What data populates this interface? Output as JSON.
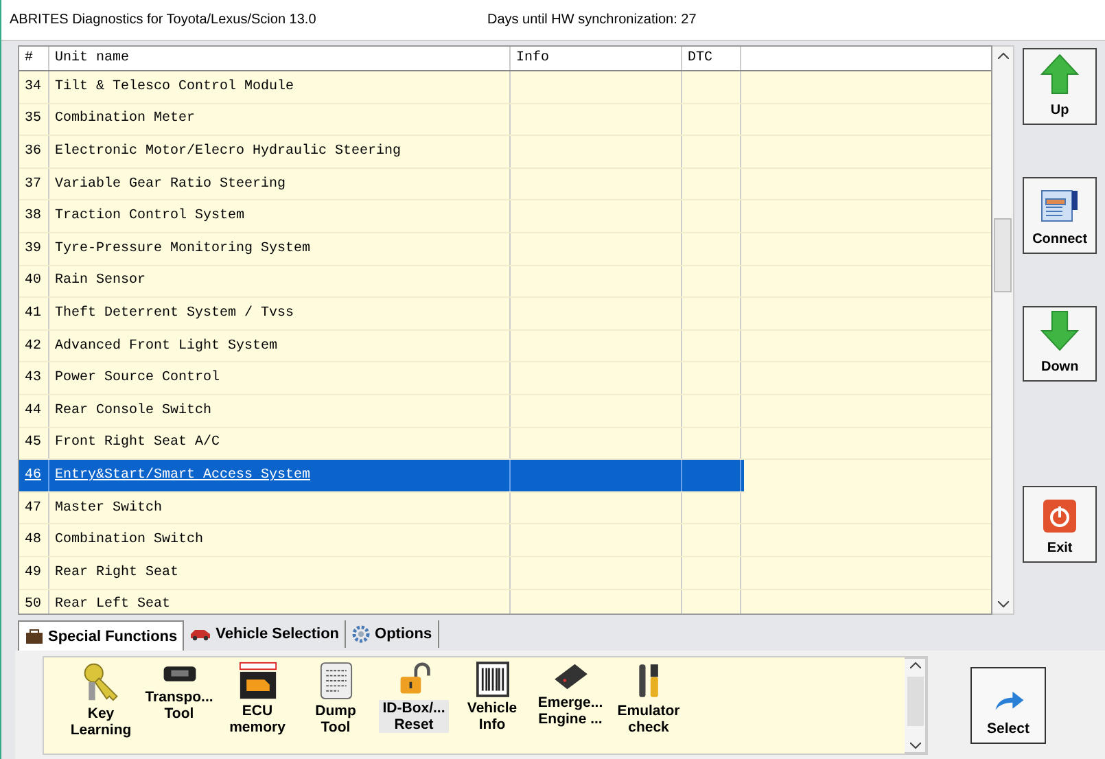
{
  "window": {
    "title": "ABRITES Diagnostics for Toyota/Lexus/Scion 13.0",
    "sync_status": "Days until HW synchronization: 27"
  },
  "table": {
    "columns": [
      "#",
      "Unit name",
      "Info",
      "DTC"
    ],
    "rows": [
      {
        "number": "34",
        "name": "Tilt & Telesco Control Module",
        "selected": false
      },
      {
        "number": "35",
        "name": "Combination Meter",
        "selected": false
      },
      {
        "number": "36",
        "name": "Electronic Motor/Elecro Hydraulic Steering",
        "selected": false
      },
      {
        "number": "37",
        "name": "Variable Gear Ratio Steering",
        "selected": false
      },
      {
        "number": "38",
        "name": "Traction Control System",
        "selected": false
      },
      {
        "number": "39",
        "name": "Tyre-Pressure Monitoring System",
        "selected": false
      },
      {
        "number": "40",
        "name": "Rain Sensor",
        "selected": false
      },
      {
        "number": "41",
        "name": "Theft Deterrent System / Tvss",
        "selected": false
      },
      {
        "number": "42",
        "name": "Advanced Front Light System",
        "selected": false
      },
      {
        "number": "43",
        "name": "Power Source Control",
        "selected": false
      },
      {
        "number": "44",
        "name": "Rear Console Switch",
        "selected": false
      },
      {
        "number": "45",
        "name": "Front Right Seat A/C",
        "selected": false
      },
      {
        "number": "46",
        "name": "Entry&Start/Smart Access System",
        "selected": true
      },
      {
        "number": "47",
        "name": "Master Switch",
        "selected": false
      },
      {
        "number": "48",
        "name": "Combination Switch",
        "selected": false
      },
      {
        "number": "49",
        "name": "Rear Right Seat",
        "selected": false
      },
      {
        "number": "50",
        "name": "Rear Left Seat",
        "selected": false
      }
    ]
  },
  "side_buttons": [
    {
      "label": "Up",
      "kind": "up"
    },
    {
      "label": "Connect",
      "kind": "connect"
    },
    {
      "label": "Down",
      "kind": "down"
    },
    {
      "label": "Exit",
      "kind": "exit"
    }
  ],
  "tabs": [
    {
      "label": "Special Functions",
      "kind": "functions",
      "selected": true
    },
    {
      "label": "Vehicle Selection",
      "kind": "vehicle",
      "selected": false
    },
    {
      "label": "Options",
      "kind": "options",
      "selected": false
    }
  ],
  "tools": [
    {
      "label": "Key Learning",
      "kind": "key",
      "selected": false
    },
    {
      "label": "Transpo... Tool",
      "kind": "transponder",
      "selected": false
    },
    {
      "label": "ECU memory",
      "kind": "ecu",
      "selected": false
    },
    {
      "label": "Dump Tool",
      "kind": "dump",
      "selected": false
    },
    {
      "label": "ID-Box/... Reset",
      "kind": "lock",
      "selected": true
    },
    {
      "label": "Vehicle Info",
      "kind": "barcode",
      "selected": false
    },
    {
      "label": "Emerge... Engine ...",
      "kind": "chip",
      "selected": false
    },
    {
      "label": "Emulator check",
      "kind": "wrench",
      "selected": false
    }
  ],
  "select_button": {
    "label": "Select"
  }
}
